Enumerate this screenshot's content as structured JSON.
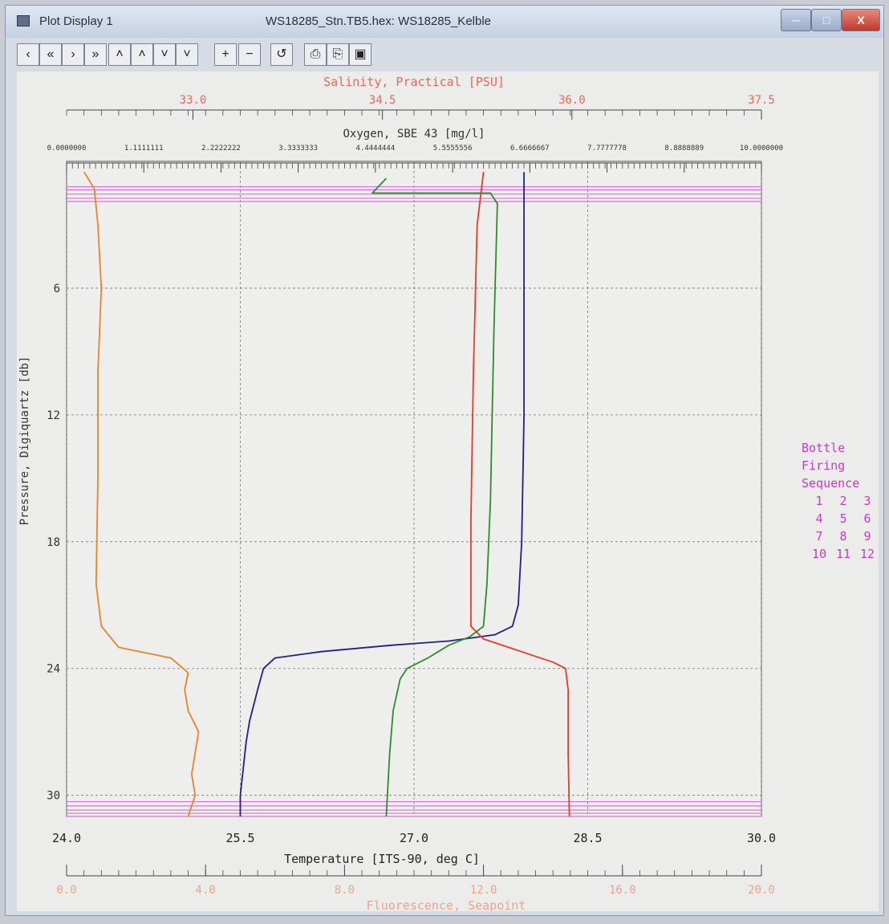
{
  "window": {
    "title": "Plot Display 1",
    "document": "WS18285_Stn.TB5.hex: WS18285_Kelble",
    "buttons": {
      "minimize": "─",
      "maximize": "□",
      "close": "X"
    }
  },
  "toolbar": [
    {
      "name": "prev-button",
      "icon": "‹"
    },
    {
      "name": "first-button",
      "icon": "«"
    },
    {
      "name": "next-button",
      "icon": "›"
    },
    {
      "name": "last-button",
      "icon": "»"
    },
    {
      "name": "up-button",
      "icon": "˄"
    },
    {
      "name": "top-button",
      "icon": "˄"
    },
    {
      "name": "down-button",
      "icon": "˅"
    },
    {
      "name": "bottom-button",
      "icon": "˅"
    },
    {
      "name": "zoom-in-button",
      "icon": "+"
    },
    {
      "name": "zoom-out-button",
      "icon": "−"
    },
    {
      "name": "reset-button",
      "icon": "↺"
    },
    {
      "name": "print-button",
      "icon": "⎙"
    },
    {
      "name": "copy-button",
      "icon": "⎘"
    },
    {
      "name": "save-button",
      "icon": "▣"
    }
  ],
  "chart_data": {
    "type": "line",
    "y_axis": {
      "label": "Pressure, Digiquartz [db]",
      "range": [
        0,
        31
      ],
      "ticks": [
        "6",
        "12",
        "18",
        "24",
        "30"
      ],
      "tick_values": [
        6,
        12,
        18,
        24,
        30
      ],
      "inverted": true
    },
    "axes_top": [
      {
        "label": "Salinity, Practical [PSU]",
        "range": [
          32.0,
          37.5
        ],
        "ticks": [
          "33.0",
          "34.5",
          "36.0",
          "37.5"
        ],
        "tick_values": [
          33.0,
          34.5,
          36.0,
          37.5
        ],
        "color": "#e26a5a"
      },
      {
        "label": "Oxygen, SBE 43 [mg/l]",
        "range": [
          0,
          10
        ],
        "ticks": [
          "0.0000000",
          "1.1111111",
          "2.2222222",
          "3.3333333",
          "4.4444444",
          "5.5555556",
          "6.6666667",
          "7.7777778",
          "8.8888889",
          "10.0000000"
        ],
        "color": "#333333"
      }
    ],
    "axes_bottom": [
      {
        "label": "Temperature [ITS-90, deg C]",
        "range": [
          24.0,
          30.0
        ],
        "ticks": [
          "24.0",
          "25.5",
          "27.0",
          "28.5",
          "30.0"
        ],
        "tick_values": [
          24.0,
          25.5,
          27.0,
          28.5,
          30.0
        ],
        "color": "#222222"
      },
      {
        "label": "Fluorescence, Seapoint",
        "range": [
          0.0,
          20.0
        ],
        "ticks": [
          "0.0",
          "4.0",
          "8.0",
          "12.0",
          "16.0",
          "20.0"
        ],
        "tick_values": [
          0,
          4,
          8,
          12,
          16,
          20
        ],
        "color": "#e7a58f"
      }
    ],
    "grid": true,
    "series": [
      {
        "color": "#1f1f8f",
        "axis": "Temperature [ITS-90, deg C]",
        "points": [
          [
            27.95,
            0.5
          ],
          [
            27.95,
            5
          ],
          [
            27.95,
            12
          ],
          [
            27.93,
            18
          ],
          [
            27.9,
            21
          ],
          [
            27.85,
            22
          ],
          [
            27.7,
            22.4
          ],
          [
            27.3,
            22.7
          ],
          [
            26.8,
            22.9
          ],
          [
            26.2,
            23.2
          ],
          [
            25.8,
            23.5
          ],
          [
            25.7,
            24.0
          ],
          [
            25.65,
            25
          ],
          [
            25.58,
            26.5
          ],
          [
            25.55,
            27.5
          ],
          [
            25.52,
            29
          ],
          [
            25.5,
            30
          ],
          [
            25.5,
            31
          ]
        ]
      },
      {
        "color": "#e83a2b",
        "axis": "Salinity, Practical [PSU]",
        "points": [
          [
            35.3,
            0.5
          ],
          [
            35.25,
            3
          ],
          [
            35.22,
            10
          ],
          [
            35.2,
            17
          ],
          [
            35.2,
            22
          ],
          [
            35.3,
            22.6
          ],
          [
            35.6,
            23.2
          ],
          [
            35.85,
            23.7
          ],
          [
            35.95,
            24.0
          ],
          [
            35.97,
            25
          ],
          [
            35.97,
            28
          ],
          [
            35.98,
            31
          ]
        ]
      },
      {
        "color": "#2e8b2e",
        "axis": "Oxygen, SBE 43 [mg/l]",
        "points": [
          [
            4.6,
            0.8
          ],
          [
            4.4,
            1.5
          ],
          [
            6.1,
            1.5
          ],
          [
            6.2,
            2.0
          ],
          [
            6.15,
            8
          ],
          [
            6.1,
            16
          ],
          [
            6.05,
            20
          ],
          [
            6.0,
            22
          ],
          [
            5.8,
            22.5
          ],
          [
            5.5,
            22.9
          ],
          [
            5.2,
            23.5
          ],
          [
            4.9,
            24.0
          ],
          [
            4.8,
            24.5
          ],
          [
            4.7,
            26
          ],
          [
            4.65,
            28
          ],
          [
            4.6,
            31
          ]
        ]
      },
      {
        "color": "#e8842a",
        "axis": "Fluorescence, Seapoint",
        "points": [
          [
            0.5,
            0.5
          ],
          [
            0.8,
            1.3
          ],
          [
            0.9,
            3
          ],
          [
            1.0,
            6
          ],
          [
            0.9,
            10
          ],
          [
            0.9,
            15
          ],
          [
            0.85,
            20
          ],
          [
            1.0,
            22
          ],
          [
            1.5,
            23
          ],
          [
            3.0,
            23.5
          ],
          [
            3.5,
            24.2
          ],
          [
            3.4,
            25
          ],
          [
            3.5,
            26
          ],
          [
            3.8,
            27
          ],
          [
            3.7,
            28
          ],
          [
            3.6,
            29
          ],
          [
            3.7,
            30
          ],
          [
            3.5,
            31
          ]
        ]
      }
    ],
    "bottle_bands": [
      1.2,
      1.35,
      1.55,
      1.75,
      1.9,
      30.3,
      30.5,
      30.7,
      30.85,
      31.0
    ],
    "legend": {
      "title": [
        "Bottle",
        "Firing",
        "Sequence"
      ],
      "rows": [
        [
          "1",
          "2",
          "3"
        ],
        [
          "4",
          "5",
          "6"
        ],
        [
          "7",
          "8",
          "9"
        ],
        [
          "10",
          "11",
          "12"
        ]
      ],
      "color": "#c03fc0"
    }
  }
}
